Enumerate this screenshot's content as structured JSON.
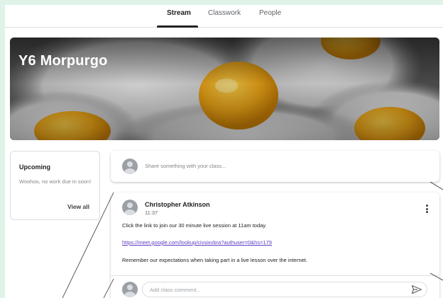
{
  "nav": {
    "tabs": [
      {
        "label": "Stream"
      },
      {
        "label": "Classwork"
      },
      {
        "label": "People"
      }
    ],
    "active_tab": "Stream"
  },
  "banner": {
    "class_name": "Y6 Morpurgo"
  },
  "upcoming": {
    "title": "Upcoming",
    "message": "Woohoo, no work due in soon!",
    "view_all_label": "View all"
  },
  "share": {
    "placeholder": "Share something with your class..."
  },
  "post": {
    "author": "Christopher Atkinson",
    "time": "11:37",
    "line1": "Click the link to join our 30 minute live session at 11am today.",
    "link": "https://meet.google.com/lookup/civsixvbra?authuser=0&hs=179",
    "line3": "Remember our expectations when taking part in a live lesson over the internet.",
    "comment_placeholder": "Add class comment..."
  },
  "colors": {
    "accent": "#202124",
    "link": "#5f3dc4",
    "outer_background": "#dff3e8",
    "yolk": "#f0a818"
  },
  "icons": [
    "user-avatar-icon",
    "more-vert-icon",
    "send-icon"
  ]
}
